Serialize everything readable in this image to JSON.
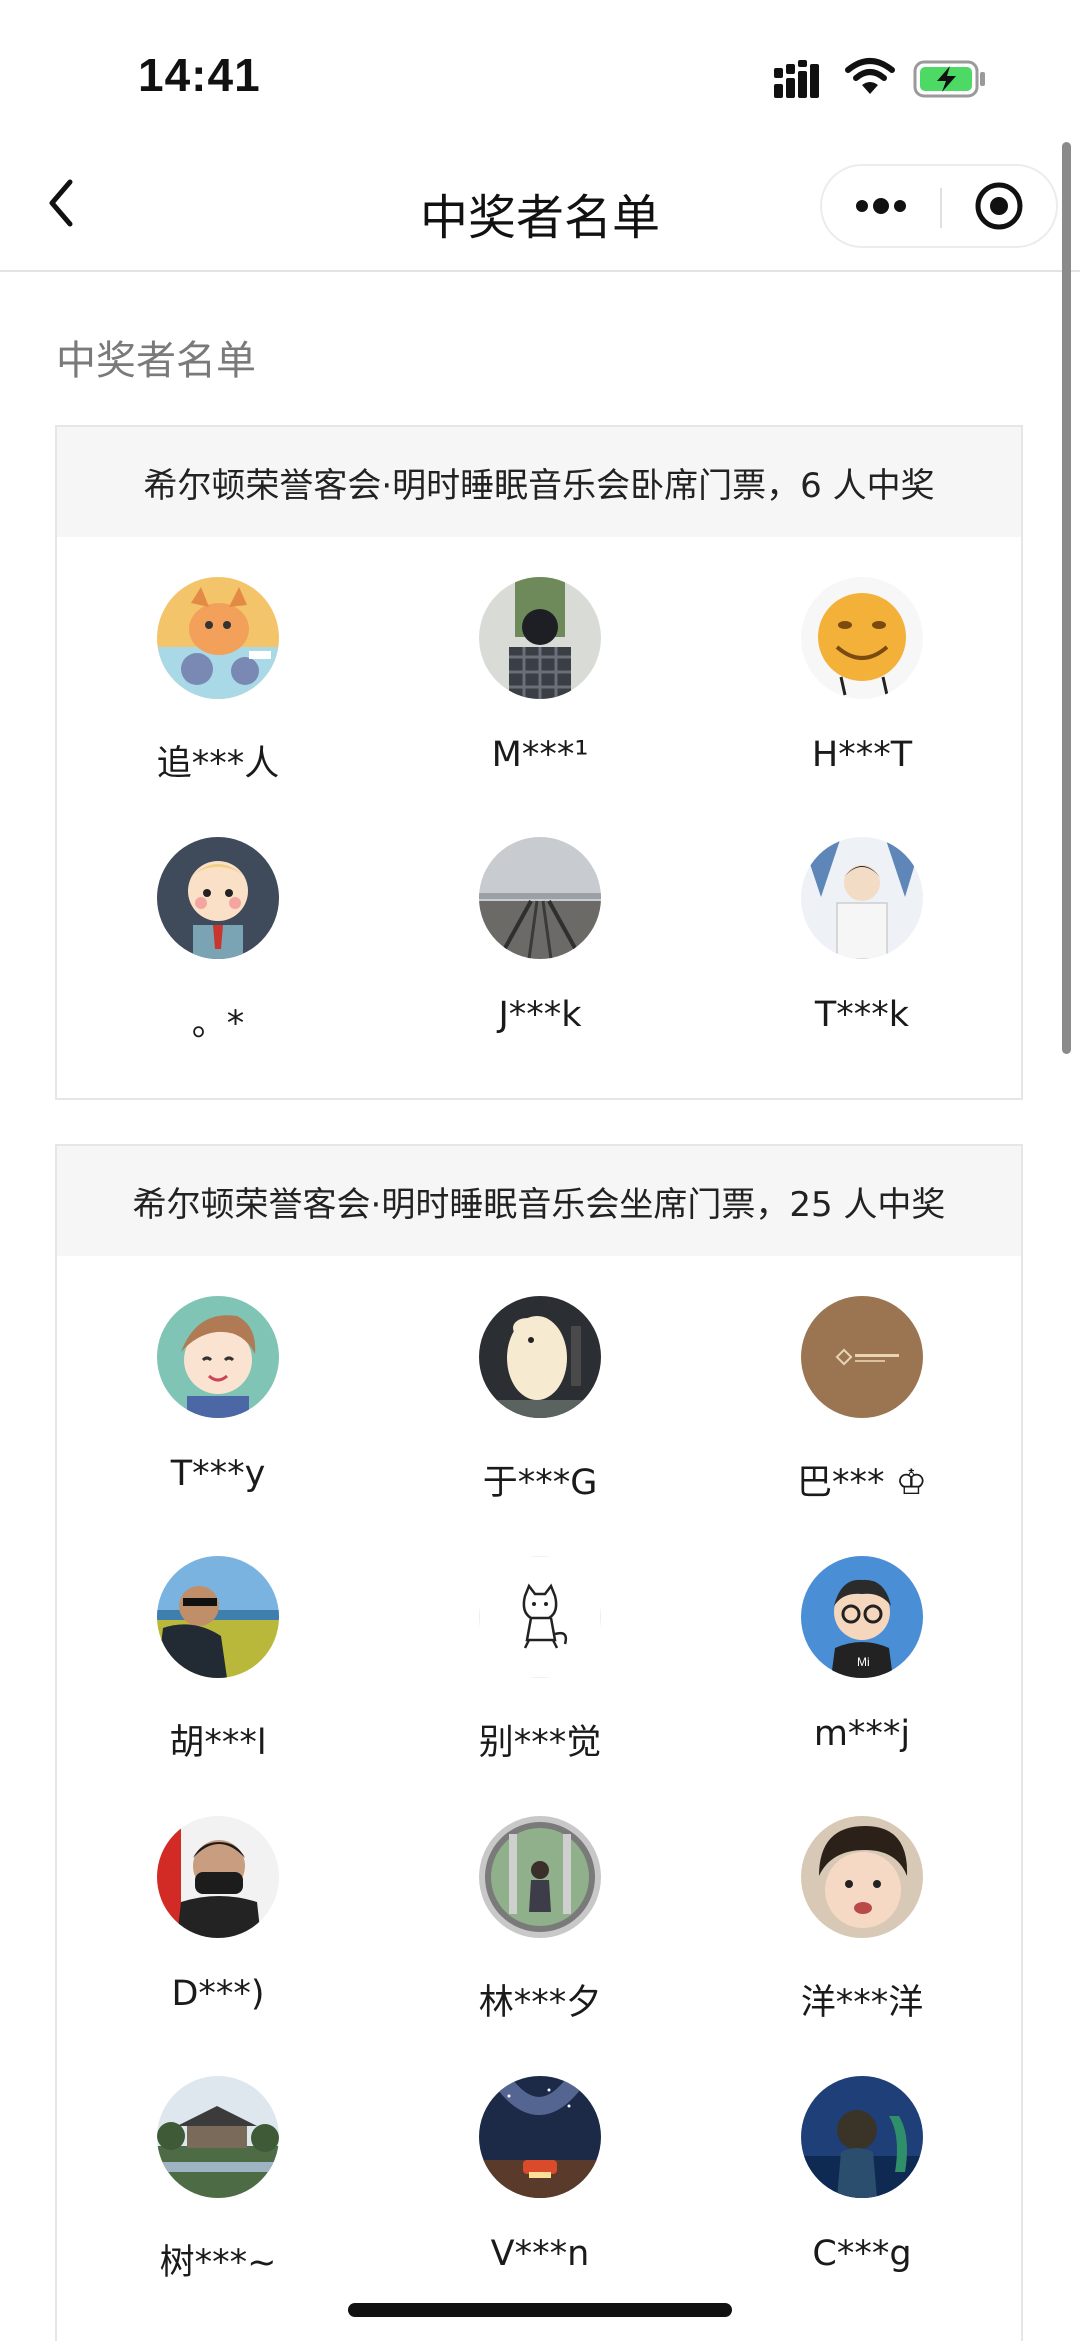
{
  "status_bar": {
    "time": "14:41",
    "icons": [
      "signal-icon",
      "wifi-icon",
      "battery-charging-icon"
    ],
    "battery_color": "#4cd964"
  },
  "nav": {
    "title": "中奖者名单",
    "back_icon": "chevron-left-icon",
    "more_icon": "more-dots-icon",
    "close_icon": "target-circle-icon"
  },
  "section_heading": "中奖者名单",
  "prizes": [
    {
      "title": "希尔顿荣誉客会·明时睡眠音乐会卧席门票，6 人中奖",
      "winners": [
        {
          "name": "追***人",
          "avatar": "cartoon-cat-on-scooter"
        },
        {
          "name": "M***¹",
          "avatar": "person-in-plaid-shirt"
        },
        {
          "name": "H***T",
          "avatar": "smiley-emoji"
        },
        {
          "name": "。*",
          "avatar": "cartoon-child"
        },
        {
          "name": "J***k",
          "avatar": "railway-tracks"
        },
        {
          "name": "T***k",
          "avatar": "illustrated-man"
        }
      ]
    },
    {
      "title": "希尔顿荣誉客会·明时睡眠音乐会坐席门票，25 人中奖",
      "winners": [
        {
          "name": "T***y",
          "avatar": "anime-boy"
        },
        {
          "name": "于***G",
          "avatar": "moomin-lamp"
        },
        {
          "name": "巴*** ♔",
          "avatar": "brown-logo"
        },
        {
          "name": "胡***l",
          "avatar": "man-in-field"
        },
        {
          "name": "别***觉",
          "avatar": "doodle-cat"
        },
        {
          "name": "m***j",
          "avatar": "cartoon-glasses-boy"
        },
        {
          "name": "D***)",
          "avatar": "masked-person"
        },
        {
          "name": "林***夕",
          "avatar": "woman-in-garden"
        },
        {
          "name": "洋***洋",
          "avatar": "baby-face"
        },
        {
          "name": "树***~",
          "avatar": "pavilion-landscape"
        },
        {
          "name": "V***n",
          "avatar": "milky-way-car"
        },
        {
          "name": "C***g",
          "avatar": "anime-night-scene"
        }
      ]
    }
  ]
}
